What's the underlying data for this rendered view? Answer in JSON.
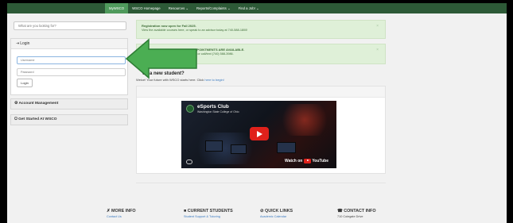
{
  "nav": {
    "items": [
      "MyWSCO",
      "WSCO Homepage",
      "Resources ⌄",
      "Reports/Complaints ⌄",
      "Find a Job! ⌄"
    ]
  },
  "search": {
    "placeholder": "What are you looking for?"
  },
  "login": {
    "heading": "Login",
    "username_placeholder": "Username",
    "password_placeholder": "Password",
    "button_label": "Login"
  },
  "sidebar": {
    "account_management": "Account Management",
    "get_started": "Get Started At WSCO"
  },
  "alerts": {
    "registration": {
      "title": "Registration now open for Fall 2025.",
      "body": "View the available courses here, or speak to an advisor today at 740-588-1800!"
    },
    "appointments": {
      "title": "N APPOINTMENTS ARE AVAILABLE.",
      "body": "today or call/text (740) 588-3986."
    }
  },
  "new_student": {
    "heading": "ou a new student?",
    "text_prefix": "Welc",
    "text_main": "e! Your future with WSCO starts here. Click ",
    "link": "here to begin!"
  },
  "video": {
    "title": "eSports Club",
    "subtitle": "Washington State College of Ohio",
    "watch_on": "Watch on",
    "platform": "YouTube"
  },
  "footer": {
    "more_info": {
      "heading": "MORE INFO",
      "link": "Contact Us",
      "icon": "pin-icon"
    },
    "current_students": {
      "heading": "CURRENT STUDENTS",
      "link": "Student Support & Tutoring",
      "icon": "book-icon"
    },
    "quick_links": {
      "heading": "QUICK LINKS",
      "link": "Academic Calendar",
      "icon": "link-icon"
    },
    "contact_info": {
      "heading": "CONTACT INFO",
      "address": "710 Colegate Drive",
      "icon": "phone-icon"
    }
  },
  "colors": {
    "nav_bg": "#2d5a37",
    "nav_active": "#4f9a5c",
    "alert_bg": "#dff0d8",
    "arrow": "#4bae53",
    "link": "#3a7ac0"
  }
}
